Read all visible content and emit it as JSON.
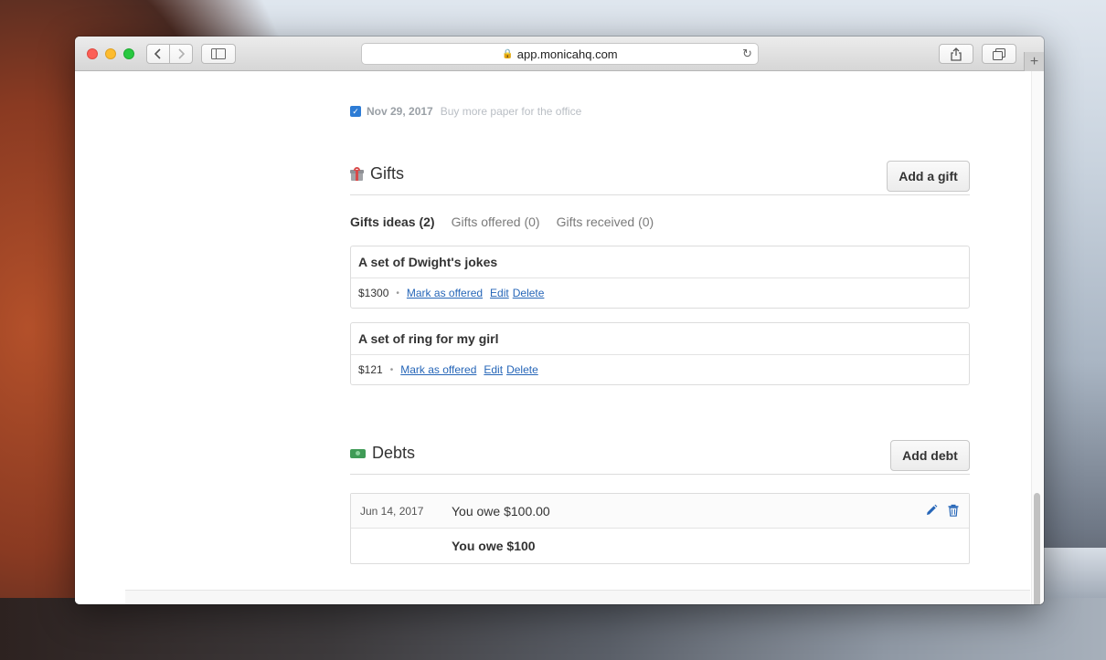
{
  "browser": {
    "url": "app.monicahq.com"
  },
  "task": {
    "date": "Nov 29, 2017",
    "text": "Buy more paper for the office"
  },
  "gifts": {
    "title": "Gifts",
    "add_label": "Add a gift",
    "tabs": [
      {
        "label": "Gifts ideas (2)",
        "active": true
      },
      {
        "label": "Gifts offered (0)",
        "active": false
      },
      {
        "label": "Gifts received (0)",
        "active": false
      }
    ],
    "items": [
      {
        "name": "A set of Dwight's jokes",
        "amount": "$1300",
        "mark_label": "Mark as offered",
        "edit_label": "Edit",
        "delete_label": "Delete"
      },
      {
        "name": "A set of ring for my girl",
        "amount": "$121",
        "mark_label": "Mark as offered",
        "edit_label": "Edit",
        "delete_label": "Delete"
      }
    ]
  },
  "debts": {
    "title": "Debts",
    "add_label": "Add debt",
    "rows": [
      {
        "date": "Jun 14, 2017",
        "description": "You owe $100.00"
      }
    ],
    "total": "You owe $100"
  },
  "colors": {
    "link": "#2666b8",
    "checkbox": "#2d7cd5"
  }
}
